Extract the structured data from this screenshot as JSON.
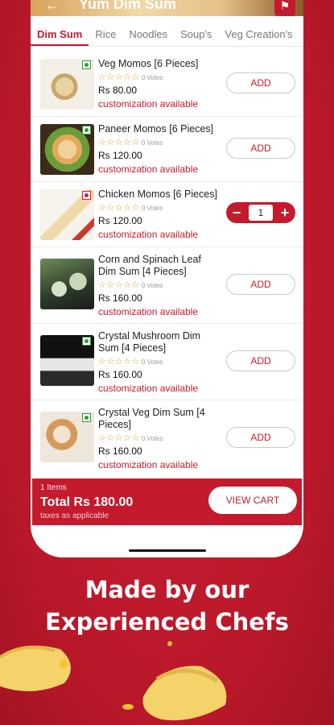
{
  "header": {
    "title": "Yum Dim Sum",
    "back_icon": "back-arrow-icon",
    "favorite_icon": "bookmark-icon"
  },
  "tabs": [
    {
      "label": "Dim Sum",
      "active": true
    },
    {
      "label": "Rice",
      "active": false
    },
    {
      "label": "Noodles",
      "active": false
    },
    {
      "label": "Soup's",
      "active": false
    },
    {
      "label": "Veg Creation's",
      "active": false
    }
  ],
  "items": [
    {
      "name": "Veg Momos [6 Pieces]",
      "votes": "0 Votes",
      "price": "Rs 80.00",
      "customization": "customization available",
      "diet": "veg",
      "action": "ADD"
    },
    {
      "name": "Paneer Momos [6 Pieces]",
      "votes": "0 Votes",
      "price": "Rs 120.00",
      "customization": "customization available",
      "diet": "veg",
      "action": "ADD"
    },
    {
      "name": "Chicken Momos [6 Pieces]",
      "votes": "0 Votes",
      "price": "Rs 120.00",
      "customization": "customization available",
      "diet": "non-veg",
      "quantity": "1",
      "minus": "−",
      "plus": "+"
    },
    {
      "name": "Corn and Spinach Leaf Dim Sum [4 Pieces]",
      "votes": "0 Votes",
      "price": "Rs 160.00",
      "customization": "customization available",
      "diet": "veg",
      "action": "ADD"
    },
    {
      "name": "Crystal Mushroom Dim Sum [4 Pieces]",
      "votes": "0 Votes",
      "price": "Rs 160.00",
      "customization": "customization available",
      "diet": "veg",
      "action": "ADD"
    },
    {
      "name": "Crystal Veg Dim Sum [4 Pieces]",
      "votes": "0 Votes",
      "price": "Rs 160.00",
      "customization": "customization available",
      "diet": "veg",
      "action": "ADD"
    }
  ],
  "rating_stars": "☆☆☆☆☆",
  "cart": {
    "count": "1 Items",
    "total": "Total Rs 180.00",
    "tax_note": "taxes as applicable",
    "button_label": "VIEW CART"
  },
  "headline": {
    "line1": "Made by our",
    "line2": "Experienced Chefs"
  },
  "colors": {
    "brand_red": "#c41a2e",
    "veg_green": "#2e9c3a",
    "star_yellow": "#e0a21b"
  }
}
